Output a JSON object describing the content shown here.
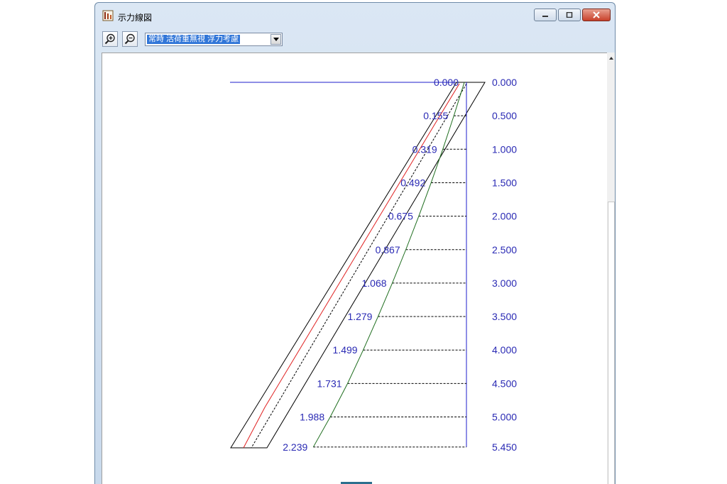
{
  "window": {
    "title": "示力線図"
  },
  "toolbar": {
    "zoom_in_icon": "zoom-in-icon",
    "zoom_out_icon": "zoom-out-icon",
    "case_select": {
      "value": "常時 活荷重無視 浮力考慮"
    }
  },
  "colors": {
    "axis": "#1d1dcc",
    "label": "#2a2ab4",
    "red_line": "#e02020",
    "green_line": "#1f6e1f",
    "outline": "#000000"
  },
  "chart_data": {
    "type": "line",
    "depth_labels": [
      "0.000",
      "0.500",
      "1.000",
      "1.500",
      "2.000",
      "2.500",
      "3.000",
      "3.500",
      "4.000",
      "4.500",
      "5.000",
      "5.450"
    ],
    "depth": [
      0.0,
      0.5,
      1.0,
      1.5,
      2.0,
      2.5,
      3.0,
      3.5,
      4.0,
      4.5,
      5.0,
      5.45
    ],
    "offset_labels": [
      "0.000",
      "0.155",
      "0.319",
      "0.492",
      "0.675",
      "0.867",
      "1.068",
      "1.279",
      "1.499",
      "1.731",
      "1.988",
      "2.239"
    ],
    "offset": [
      0.0,
      0.155,
      0.319,
      0.492,
      0.675,
      0.867,
      1.068,
      1.279,
      1.499,
      1.731,
      1.988,
      2.239
    ]
  }
}
